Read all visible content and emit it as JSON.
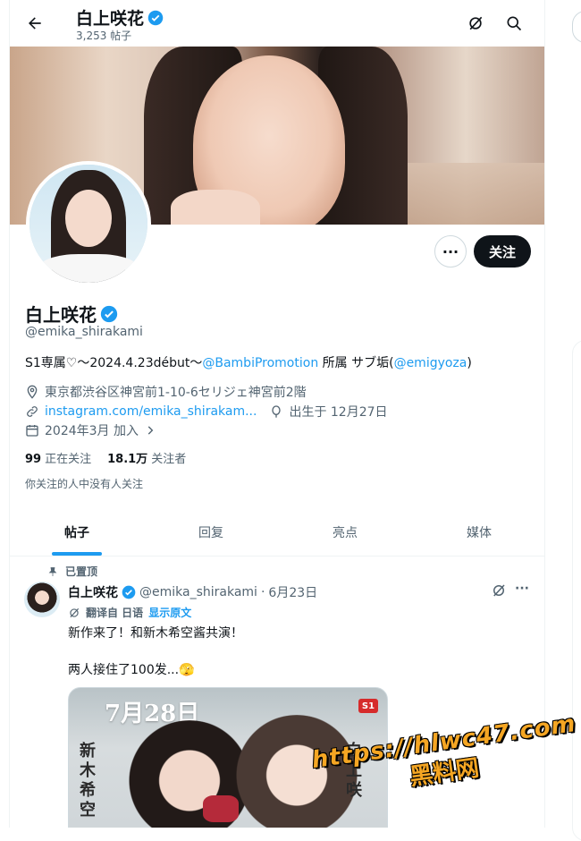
{
  "header": {
    "name": "白上咲花",
    "post_count": "3,253 帖子"
  },
  "profile": {
    "name": "白上咲花",
    "handle": "@emika_shirakami",
    "follow_label": "关注",
    "more_label": "···",
    "bio_prefix": "S1専属♡〜2024.4.23début〜",
    "bio_mention1": "@BambiPromotion",
    "bio_mid": " 所属 サブ垢(",
    "bio_mention2": "@emigyoza",
    "bio_suffix": ")",
    "location": "東京都渋谷区神宮前1-10-6セリジェ神宮前2階",
    "link": "instagram.com/emika_shirakam...",
    "birthday": "出生于 12月27日",
    "joined": "2024年3月 加入",
    "following_count": "99",
    "following_label": "正在关注",
    "followers_count": "18.1万",
    "followers_label": "关注者",
    "no_mutual": "你关注的人中没有人关注"
  },
  "tabs": [
    {
      "label": "帖子",
      "active": true
    },
    {
      "label": "回复",
      "active": false
    },
    {
      "label": "亮点",
      "active": false
    },
    {
      "label": "媒体",
      "active": false
    }
  ],
  "tweet": {
    "pinned_label": "已置顶",
    "name": "白上咲花",
    "handle": "@emika_shirakami",
    "separator": "·",
    "date": "6月23日",
    "translated_from": "翻译自 日语",
    "show_original": "显示原文",
    "text1": "新作来了！和新木希空酱共演！",
    "text2": "两人接住了100发...🫣",
    "media": {
      "date_text": "7月28日",
      "left_name": "新木希空",
      "right_name": "白上咲",
      "logo": "S1"
    }
  },
  "watermark": {
    "url": "https://hlwc47.com",
    "cn": "黑料网"
  },
  "colors": {
    "accent": "#1d9bf0",
    "text": "#0f1419",
    "secondary": "#536471",
    "follow_bg": "#0f1419"
  }
}
